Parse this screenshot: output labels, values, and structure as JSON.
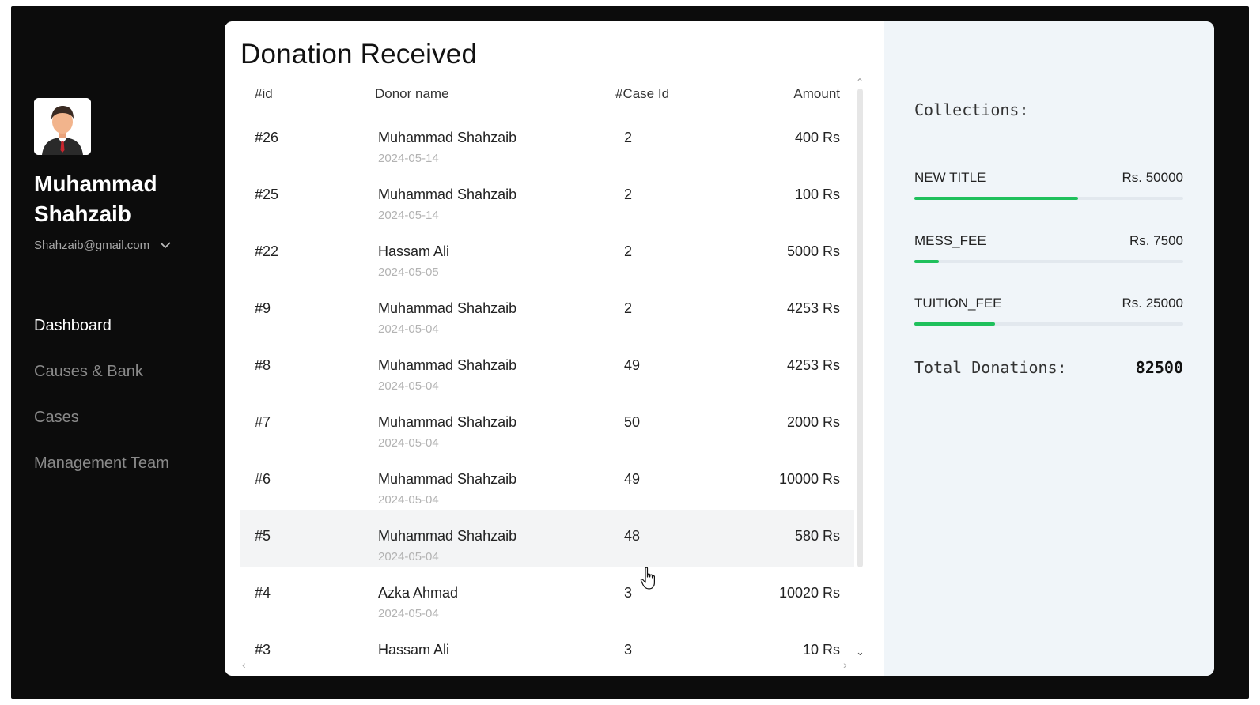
{
  "user": {
    "name": "Muhammad Shahzaib",
    "email": "Shahzaib@gmail.com"
  },
  "nav": {
    "items": [
      {
        "label": "Dashboard",
        "active": true
      },
      {
        "label": "Causes & Bank",
        "active": false
      },
      {
        "label": "Cases",
        "active": false
      },
      {
        "label": "Management Team",
        "active": false
      }
    ]
  },
  "main": {
    "title": "Donation Received",
    "columns": {
      "id": "#id",
      "name": "Donor name",
      "case": "#Case Id",
      "amount": "Amount"
    },
    "rows": [
      {
        "id": "#26",
        "name": "Muhammad Shahzaib",
        "date": "2024-05-14",
        "case": "2",
        "amount": "400 Rs"
      },
      {
        "id": "#25",
        "name": "Muhammad Shahzaib",
        "date": "2024-05-14",
        "case": "2",
        "amount": "100 Rs"
      },
      {
        "id": "#22",
        "name": "Hassam Ali",
        "date": "2024-05-05",
        "case": "2",
        "amount": "5000 Rs"
      },
      {
        "id": "#9",
        "name": "Muhammad Shahzaib",
        "date": "2024-05-04",
        "case": "2",
        "amount": "4253 Rs"
      },
      {
        "id": "#8",
        "name": "Muhammad Shahzaib",
        "date": "2024-05-04",
        "case": "49",
        "amount": "4253 Rs"
      },
      {
        "id": "#7",
        "name": "Muhammad Shahzaib",
        "date": "2024-05-04",
        "case": "50",
        "amount": "2000 Rs"
      },
      {
        "id": "#6",
        "name": "Muhammad Shahzaib",
        "date": "2024-05-04",
        "case": "49",
        "amount": "10000 Rs"
      },
      {
        "id": "#5",
        "name": "Muhammad Shahzaib",
        "date": "2024-05-04",
        "case": "48",
        "amount": "580 Rs"
      },
      {
        "id": "#4",
        "name": "Azka Ahmad",
        "date": "2024-05-04",
        "case": "3",
        "amount": "10020 Rs"
      },
      {
        "id": "#3",
        "name": "Hassam Ali",
        "date": "",
        "case": "3",
        "amount": "10 Rs"
      }
    ]
  },
  "collections": {
    "title": "Collections:",
    "items": [
      {
        "name": "NEW TITLE",
        "amount": "Rs. 50000",
        "progress": 0.61
      },
      {
        "name": "MESS_FEE",
        "amount": "Rs. 7500",
        "progress": 0.09
      },
      {
        "name": "TUITION_FEE",
        "amount": "Rs. 25000",
        "progress": 0.3
      }
    ],
    "total_label": "Total Donations:",
    "total_value": "82500"
  },
  "colors": {
    "sidebar_bg": "#0c0c0c",
    "panel_bg": "#f0f5f9",
    "progress": "#1fc05c",
    "row_hover": "#f3f4f5"
  }
}
